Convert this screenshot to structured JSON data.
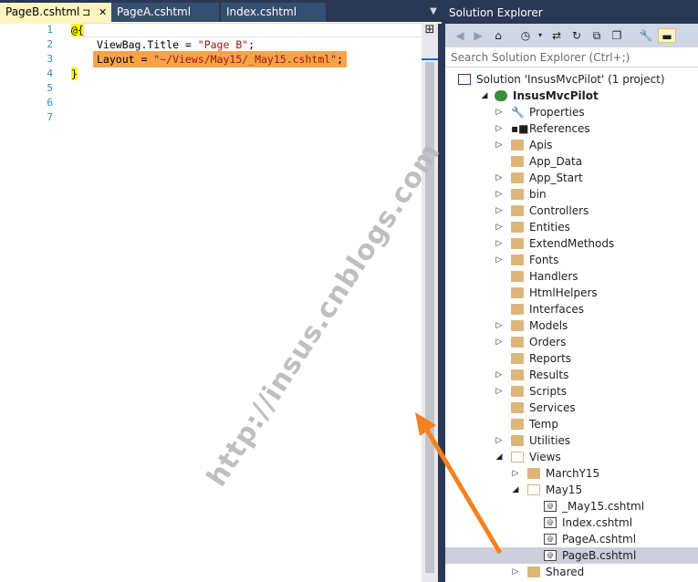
{
  "editor": {
    "tabs": [
      {
        "label": "PageB.cshtml",
        "active": true,
        "pin": "⊐",
        "close": "✕"
      },
      {
        "label": "PageA.cshtml",
        "active": false
      },
      {
        "label": "Index.cshtml",
        "active": false
      }
    ],
    "line_numbers": [
      "1",
      "2",
      "3",
      "4",
      "5",
      "6",
      "7"
    ],
    "lines": {
      "l1": "@{",
      "l2_a": "ViewBag.Title = ",
      "l2_b": "\"Page B\"",
      "l2_c": ";",
      "l3_a": "Layout = ",
      "l3_b": "\"~/Views/May15/_May15.cshtml\"",
      "l3_c": ";",
      "l4": "}"
    },
    "colors": {
      "tab_active": "#fff5c1",
      "highlight": "#f7a449",
      "line_number": "#2b91af",
      "string": "#a31515"
    }
  },
  "solution_explorer": {
    "title": "Solution Explorer",
    "search_placeholder": "Search Solution Explorer (Ctrl+;)",
    "toolbar_icons": [
      "back-icon",
      "forward-icon",
      "home-icon",
      "history-icon",
      "dropdown-icon",
      "sync-icon",
      "refresh-icon",
      "collapse-all-icon",
      "show-all-files-icon",
      "properties-wrench-icon",
      "preview-icon"
    ],
    "tree": [
      {
        "label": "Solution 'InsusMvcPilot' (1 project)",
        "icon": "solution",
        "indent": 0,
        "expander": "",
        "bold": false
      },
      {
        "label": "InsusMvcPilot",
        "icon": "project",
        "indent": 1,
        "expander": "◢",
        "bold": true
      },
      {
        "label": "Properties",
        "icon": "wrench",
        "indent": 2,
        "expander": "▷"
      },
      {
        "label": "References",
        "icon": "references",
        "indent": 2,
        "expander": "▷"
      },
      {
        "label": "Apis",
        "icon": "folder",
        "indent": 2,
        "expander": "▷"
      },
      {
        "label": "App_Data",
        "icon": "folder",
        "indent": 2,
        "expander": ""
      },
      {
        "label": "App_Start",
        "icon": "folder",
        "indent": 2,
        "expander": "▷"
      },
      {
        "label": "bin",
        "icon": "folder",
        "indent": 2,
        "expander": "▷"
      },
      {
        "label": "Controllers",
        "icon": "folder",
        "indent": 2,
        "expander": "▷"
      },
      {
        "label": "Entities",
        "icon": "folder",
        "indent": 2,
        "expander": "▷"
      },
      {
        "label": "ExtendMethods",
        "icon": "folder",
        "indent": 2,
        "expander": "▷"
      },
      {
        "label": "Fonts",
        "icon": "folder",
        "indent": 2,
        "expander": "▷"
      },
      {
        "label": "Handlers",
        "icon": "folder",
        "indent": 2,
        "expander": ""
      },
      {
        "label": "HtmlHelpers",
        "icon": "folder",
        "indent": 2,
        "expander": ""
      },
      {
        "label": "Interfaces",
        "icon": "folder",
        "indent": 2,
        "expander": ""
      },
      {
        "label": "Models",
        "icon": "folder",
        "indent": 2,
        "expander": "▷"
      },
      {
        "label": "Orders",
        "icon": "folder",
        "indent": 2,
        "expander": "▷"
      },
      {
        "label": "Reports",
        "icon": "folder",
        "indent": 2,
        "expander": ""
      },
      {
        "label": "Results",
        "icon": "folder",
        "indent": 2,
        "expander": "▷"
      },
      {
        "label": "Scripts",
        "icon": "folder",
        "indent": 2,
        "expander": "▷"
      },
      {
        "label": "Services",
        "icon": "folder",
        "indent": 2,
        "expander": ""
      },
      {
        "label": "Temp",
        "icon": "folder",
        "indent": 2,
        "expander": ""
      },
      {
        "label": "Utilities",
        "icon": "folder",
        "indent": 2,
        "expander": "▷"
      },
      {
        "label": "Views",
        "icon": "folder-open",
        "indent": 2,
        "expander": "◢"
      },
      {
        "label": "MarchY15",
        "icon": "folder",
        "indent": 3,
        "expander": "▷"
      },
      {
        "label": "May15",
        "icon": "folder-open",
        "indent": 3,
        "expander": "◢"
      },
      {
        "label": "_May15.cshtml",
        "icon": "file",
        "indent": 4,
        "expander": ""
      },
      {
        "label": "Index.cshtml",
        "icon": "file",
        "indent": 4,
        "expander": ""
      },
      {
        "label": "PageA.cshtml",
        "icon": "file",
        "indent": 4,
        "expander": ""
      },
      {
        "label": "PageB.cshtml",
        "icon": "file",
        "indent": 4,
        "expander": "",
        "selected": true
      },
      {
        "label": "Shared",
        "icon": "folder",
        "indent": 3,
        "expander": "▷"
      }
    ]
  },
  "watermark": {
    "text": "http://insus.cnblogs.com"
  },
  "annotation": {
    "color": "#f58220"
  }
}
